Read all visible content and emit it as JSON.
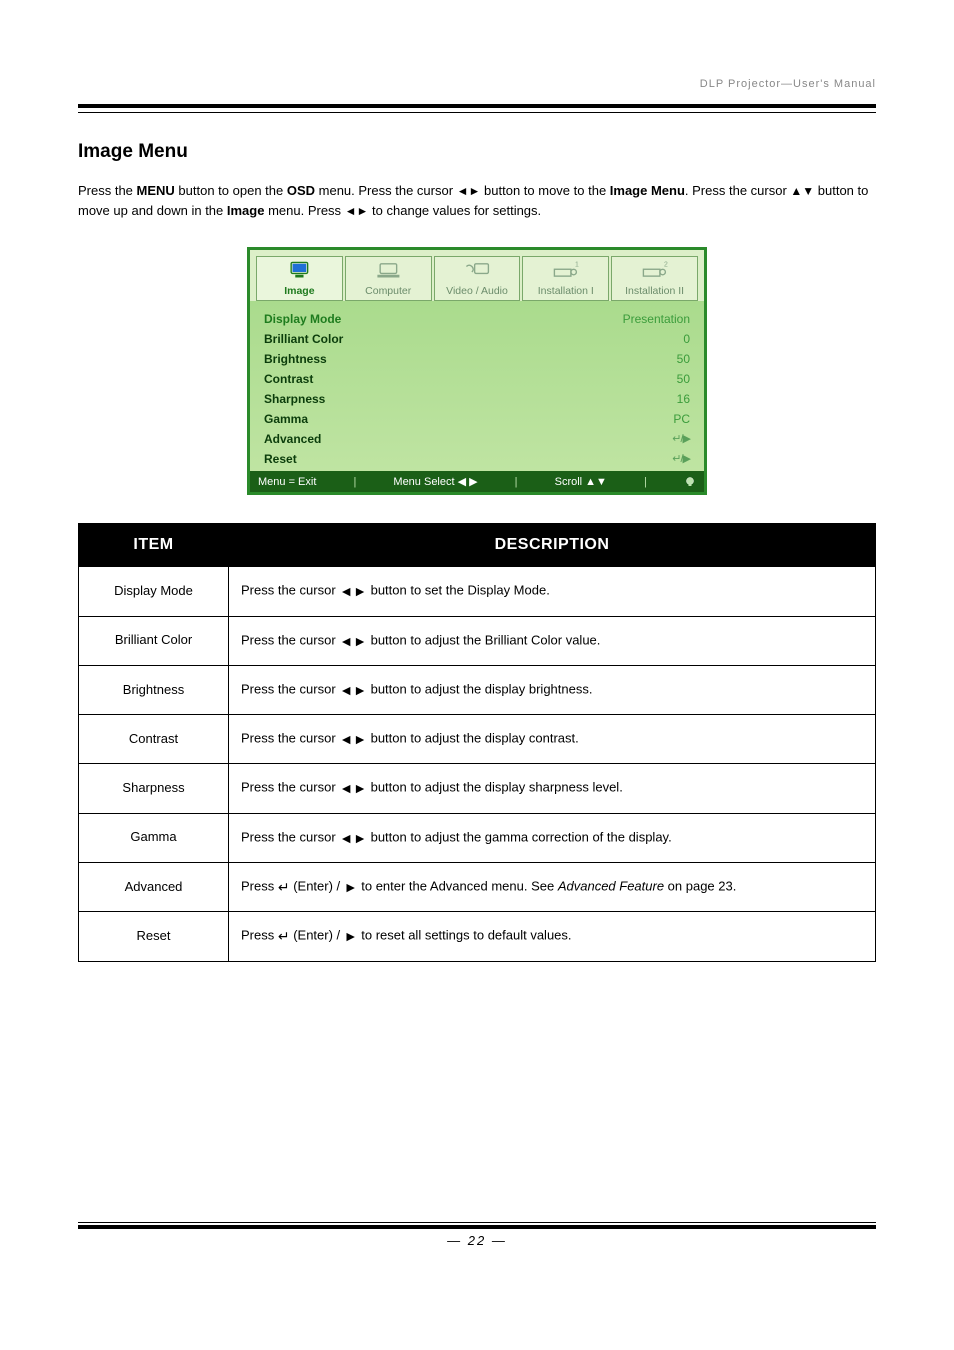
{
  "doc_header": "DLP Projector—User's Manual",
  "section_title": "Image Menu",
  "intro_1": "Press the ",
  "intro_menu_bold": "MENU",
  "intro_2": " button to open the ",
  "intro_osd_bold": "OSD",
  "intro_3": " menu. Press the cursor ",
  "intro_lr_arrows": "◄►",
  "intro_4": " button to move to the ",
  "intro_image_bold": "Image Menu",
  "intro_5": ". Press the cursor ",
  "intro_ud_arrows": "▲▼",
  "intro_6": " button to move up and down in the ",
  "intro_image_bold2": "Image",
  "intro_7": " menu. Press ",
  "intro_lr_arrows2": "◄►",
  "intro_8": " to change values for settings.",
  "tabs": {
    "image": "Image",
    "computer": "Computer",
    "video_audio": "Video / Audio",
    "install1": "Installation I",
    "install2": "Installation II"
  },
  "osd_rows": {
    "display_mode": {
      "label": "Display Mode",
      "value": "Presentation"
    },
    "brilliant_color": {
      "label": "Brilliant Color",
      "value": "0"
    },
    "brightness": {
      "label": "Brightness",
      "value": "50"
    },
    "contrast": {
      "label": "Contrast",
      "value": "50"
    },
    "sharpness": {
      "label": "Sharpness",
      "value": "16"
    },
    "gamma": {
      "label": "Gamma",
      "value": "PC"
    },
    "advanced": {
      "label": "Advanced",
      "symbol": "↵/▶"
    },
    "reset": {
      "label": "Reset",
      "symbol": "↵/▶"
    }
  },
  "osd_footer": {
    "exit": "Menu = Exit",
    "select": "Menu Select ◀ ▶",
    "scroll": "Scroll ▲▼"
  },
  "table": {
    "head_item": "ITEM",
    "head_desc": "DESCRIPTION",
    "rows": [
      {
        "item": "Display Mode",
        "desc_pre": "Press the cursor ",
        "desc_glyph": "◄►",
        "desc_post": " button to set the Display Mode."
      },
      {
        "item": "Brilliant Color",
        "desc_pre": "Press the cursor ",
        "desc_glyph": "◄►",
        "desc_post": " button to adjust the Brilliant Color value."
      },
      {
        "item": "Brightness",
        "desc_pre": "Press the cursor ",
        "desc_glyph": "◄►",
        "desc_post": " button to adjust the display brightness."
      },
      {
        "item": "Contrast",
        "desc_pre": "Press the cursor ",
        "desc_glyph": "◄►",
        "desc_post": " button to adjust the display contrast."
      },
      {
        "item": "Sharpness",
        "desc_pre": "Press the cursor ",
        "desc_glyph": "◄►",
        "desc_post": " button to adjust the display sharpness level."
      },
      {
        "item": "Gamma",
        "desc_pre": "Press the cursor ",
        "desc_glyph": "◄►",
        "desc_post": " button to adjust the gamma correction of the display."
      },
      {
        "item": "Advanced",
        "desc_pre": "Press ",
        "desc_glyph": "↵",
        "desc_mid": " (Enter) / ",
        "desc_glyph2": "►",
        "desc_post": " to enter the Advanced menu. See ",
        "desc_italic": "Advanced Feature",
        "desc_tail": " on page 23."
      },
      {
        "item": "Reset",
        "desc_pre": "Press ",
        "desc_glyph": "↵",
        "desc_mid": " (Enter) / ",
        "desc_glyph2": "►",
        "desc_post": " to reset all settings to default values."
      }
    ]
  },
  "page_number": "— 22 —"
}
